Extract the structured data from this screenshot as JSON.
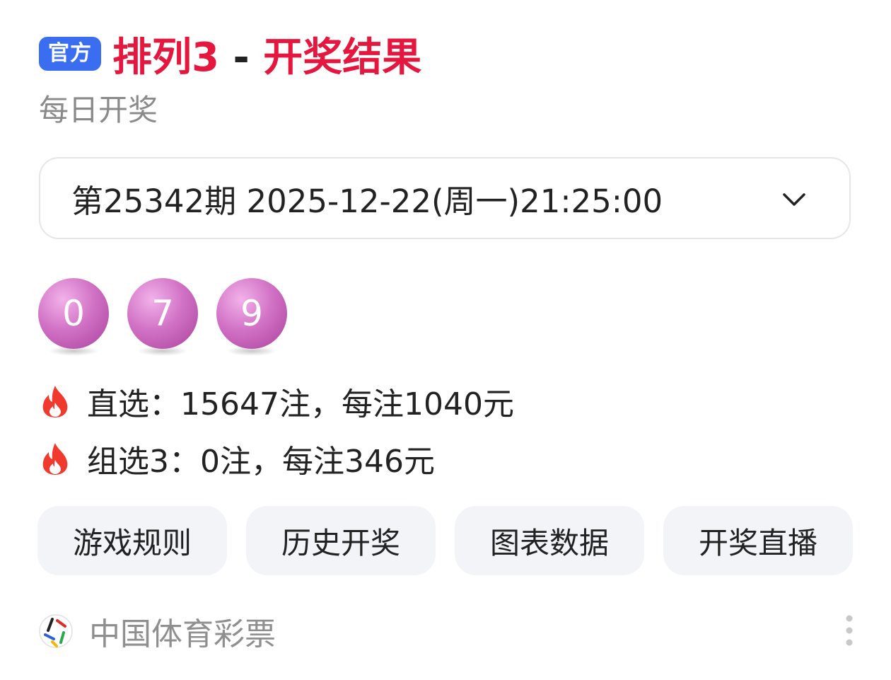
{
  "header": {
    "badge": "官方",
    "title_game": "排列3",
    "title_separator": "-",
    "title_suffix": "开奖结果",
    "subtitle": "每日开奖",
    "accent_color": "#e5173f",
    "badge_color": "#3b6df0"
  },
  "draw_select": {
    "value": "第25342期 2025-12-22(周一)21:25:00",
    "icon": "chevron-down-icon"
  },
  "balls": [
    "0",
    "7",
    "9"
  ],
  "prizes": [
    {
      "icon": "fire-icon",
      "text": "直选：15647注，每注1040元"
    },
    {
      "icon": "fire-icon",
      "text": "组选3：0注，每注346元"
    }
  ],
  "actions": [
    {
      "label": "游戏规则"
    },
    {
      "label": "历史开奖"
    },
    {
      "label": "图表数据"
    },
    {
      "label": "开奖直播"
    }
  ],
  "footer": {
    "logo_icon": "china-sports-lottery-logo-icon",
    "source_name": "中国体育彩票",
    "more_icon": "vertical-dots-icon"
  }
}
